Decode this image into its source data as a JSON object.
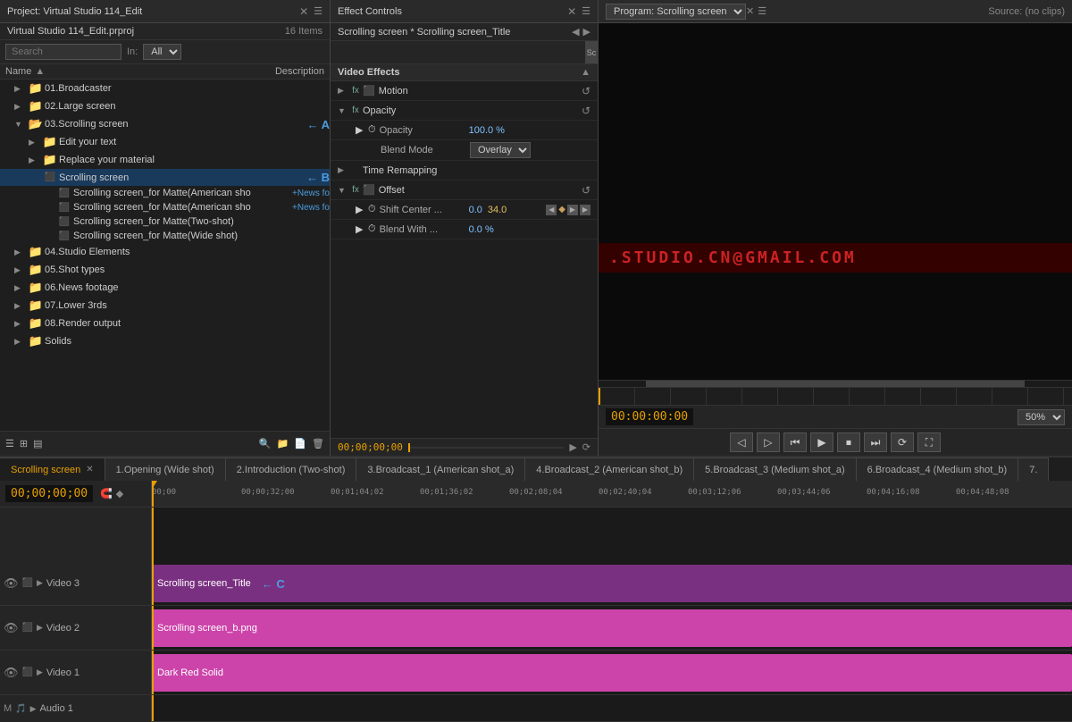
{
  "project": {
    "title": "Project: Virtual Studio 114_Edit",
    "name": "Virtual Studio 114_Edit.prproj",
    "items_count": "16 Items",
    "search_placeholder": "Search",
    "in_label": "In:",
    "in_option": "All",
    "col_name": "Name",
    "col_desc": "Description",
    "folders": [
      {
        "id": "f1",
        "label": "01.Broadcaster",
        "level": 1,
        "expanded": false
      },
      {
        "id": "f2",
        "label": "02.Large screen",
        "level": 1,
        "expanded": false
      },
      {
        "id": "f3",
        "label": "03.Scrolling screen",
        "level": 1,
        "expanded": true,
        "annotation": "← A"
      },
      {
        "id": "f3-1",
        "label": "Edit your text",
        "level": 2,
        "type": "sub"
      },
      {
        "id": "f3-2",
        "label": "Replace your material",
        "level": 2,
        "type": "sub"
      },
      {
        "id": "f3-3",
        "label": "Scrolling screen",
        "level": 2,
        "type": "clip",
        "selected": true,
        "annotation": "← B"
      },
      {
        "id": "f3-4",
        "label": "Scrolling screen_for Matte(American sho",
        "level": 3,
        "type": "cliprow",
        "tag": "+News fo"
      },
      {
        "id": "f3-5",
        "label": "Scrolling screen_for Matte(American sho",
        "level": 3,
        "type": "cliprow",
        "tag": "+News fo"
      },
      {
        "id": "f3-6",
        "label": "Scrolling screen_for Matte(Two-shot)",
        "level": 3,
        "type": "cliprow"
      },
      {
        "id": "f3-7",
        "label": "Scrolling screen_for Matte(Wide shot)",
        "level": 3,
        "type": "cliprow"
      },
      {
        "id": "f4",
        "label": "04.Studio Elements",
        "level": 1,
        "expanded": false
      },
      {
        "id": "f5",
        "label": "05.Shot types",
        "level": 1,
        "expanded": false
      },
      {
        "id": "f6",
        "label": "06.News footage",
        "level": 1,
        "expanded": false
      },
      {
        "id": "f7",
        "label": "07.Lower 3rds",
        "level": 1,
        "expanded": false
      },
      {
        "id": "f8",
        "label": "08.Render output",
        "level": 1,
        "expanded": false
      },
      {
        "id": "f9",
        "label": "Solids",
        "level": 1,
        "expanded": false
      }
    ]
  },
  "effect_controls": {
    "title": "Effect Controls",
    "clip_label": "Scrolling screen * Scrolling screen_Title",
    "video_effects_label": "Video Effects",
    "effects": [
      {
        "id": "motion",
        "label": "Motion",
        "expanded": false,
        "has_reset": true
      },
      {
        "id": "opacity",
        "label": "Opacity",
        "expanded": true,
        "has_reset": true,
        "sub": [
          {
            "label": "Opacity",
            "value": "100.0 %",
            "type": "value"
          },
          {
            "label": "Blend Mode",
            "value": "Overlay",
            "type": "select"
          }
        ]
      },
      {
        "id": "time_remap",
        "label": "Time Remapping",
        "expanded": false,
        "has_reset": false
      },
      {
        "id": "offset",
        "label": "Offset",
        "expanded": true,
        "has_reset": true,
        "sub": [
          {
            "label": "Shift Center ...",
            "value1": "0.0",
            "value2": "34.0",
            "type": "shift"
          },
          {
            "label": "Blend With ...",
            "value": "0.0 %",
            "type": "value"
          }
        ]
      }
    ],
    "timecode": "00;00;00;00"
  },
  "program_monitor": {
    "title": "Program: Scrolling screen",
    "source_label": "Source: (no clips)",
    "scrolling_text": ".STUDIO.CN@GMAIL.COM",
    "timecode": "00:00:00:00",
    "zoom": "50%"
  },
  "timeline": {
    "tabs": [
      {
        "id": "t1",
        "label": "Scrolling screen",
        "active": true,
        "closeable": true
      },
      {
        "id": "t2",
        "label": "1.Opening (Wide shot)",
        "active": false
      },
      {
        "id": "t3",
        "label": "2.Introduction (Two-shot)",
        "active": false
      },
      {
        "id": "t4",
        "label": "3.Broadcast_1 (American shot_a)",
        "active": false
      },
      {
        "id": "t5",
        "label": "4.Broadcast_2 (American shot_b)",
        "active": false
      },
      {
        "id": "t6",
        "label": "5.Broadcast_3 (Medium shot_a)",
        "active": false
      },
      {
        "id": "t7",
        "label": "6.Broadcast_4 (Medium shot_b)",
        "active": false
      },
      {
        "id": "t8",
        "label": "7.",
        "active": false
      }
    ],
    "timecode": "00;00;00;00",
    "ruler": [
      "00;00",
      "00;00;32;00",
      "00;01;04;02",
      "00;01;36;02",
      "00;02;08;04",
      "00;02;40;04",
      "00;03;12;06",
      "00;03;44;06",
      "00;04;16;08",
      "00;04;48;08"
    ],
    "tracks": [
      {
        "id": "v3",
        "label": "Video 3",
        "clip": "Scrolling screen_Title",
        "clip_color": "#7a3080",
        "annotation": "← C"
      },
      {
        "id": "v2",
        "label": "Video 2",
        "clip": "Scrolling screen_b.png",
        "clip_color": "#cc44aa"
      },
      {
        "id": "v1",
        "label": "Video 1",
        "clip": "Dark Red Solid",
        "clip_color": "#cc44aa"
      },
      {
        "id": "a1",
        "label": "Audio 1",
        "clip": "",
        "clip_color": "transparent"
      }
    ]
  }
}
